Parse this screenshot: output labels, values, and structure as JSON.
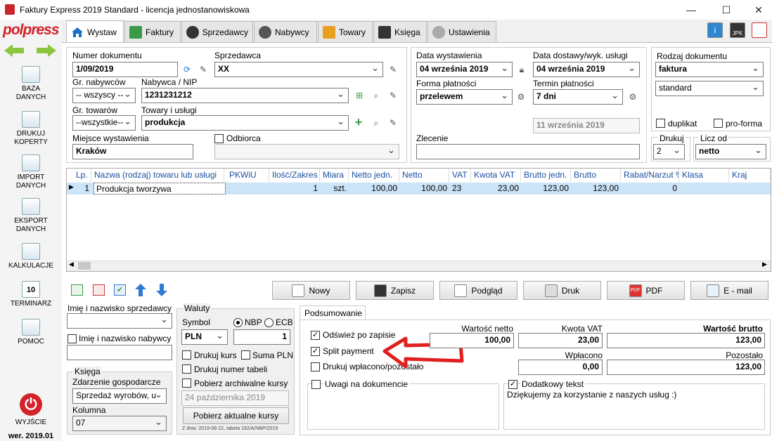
{
  "window": {
    "title": "Faktury Express 2019 Standard - licencja jednostanowiskowa"
  },
  "sidebar": {
    "logo": "polpress",
    "items": [
      {
        "label": "BAZA DANYCH"
      },
      {
        "label": "DRUKUJ KOPERTY"
      },
      {
        "label": "IMPORT DANYCH"
      },
      {
        "label": "EKSPORT DANYCH"
      },
      {
        "label": "KALKULACJE"
      },
      {
        "label": "TERMINARZ"
      },
      {
        "label": "POMOC"
      },
      {
        "label": "WYJŚCIE"
      }
    ],
    "calendar_day": "10",
    "version": "wer. 2019.01"
  },
  "tabs": [
    {
      "label": "Wystaw"
    },
    {
      "label": "Faktury"
    },
    {
      "label": "Sprzedawcy"
    },
    {
      "label": "Nabywcy"
    },
    {
      "label": "Towary"
    },
    {
      "label": "Księga"
    },
    {
      "label": "Ustawienia"
    }
  ],
  "top_right_icons": {
    "jpk": "JPK"
  },
  "form": {
    "numer_label": "Numer dokumentu",
    "numer_value": "1/09/2019",
    "sprzedawca_label": "Sprzedawca",
    "sprzedawca_value": "XX",
    "gr_nabywcow_label": "Gr. nabywców",
    "gr_nabywcow_value": "-- wszyscy --",
    "nabywca_label": "Nabywca / NIP",
    "nabywca_value": "1231231212",
    "gr_towarow_label": "Gr. towarów",
    "gr_towarow_value": "--wszystkie--",
    "towary_label": "Towary i usługi",
    "towary_value": "produkcja",
    "miejsce_label": "Miejsce wystawienia",
    "miejsce_value": "Kraków",
    "odbiorca_label": "Odbiorca",
    "data_wyst_label": "Data wystawienia",
    "data_wyst_value": "04  września  2019",
    "data_dost_label": "Data dostawy/wyk. usługi",
    "data_dost_value": "04  września  2019",
    "forma_label": "Forma płatności",
    "forma_value": "przelewem",
    "termin_label": "Termin płatności",
    "termin_value": "7 dni",
    "termin_date_value": "11  września  2019",
    "zlecenie_label": "Zlecenie",
    "rodzaj_label": "Rodzaj dokumentu",
    "rodzaj_value": "faktura",
    "rodzaj2_value": "standard",
    "duplikat_label": "duplikat",
    "proforma_label": "pro-forma",
    "drukuj_label": "Drukuj",
    "drukuj_value": "2",
    "licz_label": "Licz od",
    "licz_value": "netto"
  },
  "table": {
    "headers": [
      "Lp.",
      "Nazwa (rodzaj) towaru lub usługi",
      "PKWiU",
      "Ilość/Zakres",
      "Miara",
      "Netto jedn.",
      "Netto",
      "VAT",
      "Kwota VAT",
      "Brutto jedn.",
      "Brutto",
      "Rabat/Narzut %",
      "Klasa",
      "Kraj"
    ],
    "rows": [
      {
        "lp": "1",
        "nazwa": "Produkcja tworzywa",
        "pkwiu": "",
        "ilosc": "1",
        "miara": "szt.",
        "netto_jedn": "100,00",
        "netto": "100,00",
        "vat": "23",
        "kwota_vat": "23,00",
        "brutto_jedn": "123,00",
        "brutto": "123,00",
        "rabat": "0",
        "klasa": "",
        "kraj": ""
      }
    ]
  },
  "buttons": {
    "nowy": "Nowy",
    "zapisz": "Zapisz",
    "podglad": "Podgląd",
    "druk": "Druk",
    "pdf": "PDF",
    "email": "E - mail",
    "pdf_icon": "PDF"
  },
  "bottom_left": {
    "sprzedawca_label": "Imię i nazwisko sprzedawcy",
    "nabywca_label": "Imię i nazwisko nabywcy",
    "ksiega_label": "Księga",
    "zdarzenie_label": "Zdarzenie gospodarcze",
    "zdarzenie_value": "Sprzedaż wyrobów, u",
    "kolumna_label": "Kolumna",
    "kolumna_value": "07"
  },
  "waluty": {
    "title": "Waluty",
    "symbol_label": "Symbol",
    "symbol_value": "PLN",
    "nbp_label": "NBP",
    "ecb_label": "ECB",
    "kurs_value": "1",
    "drukuj_kurs": "Drukuj kurs",
    "suma_pln": "Suma PLN",
    "drukuj_numer": "Drukuj numer tabeli",
    "pobierz_arch": "Pobierz archiwalne kursy",
    "arch_date": "24  października  2019",
    "pobierz_btn": "Pobierz aktualne kursy",
    "note": "Z dnia: 2019-08-22, tabela 162/A/NBP/2019"
  },
  "podsumowanie": {
    "tab_label": "Podsumowanie",
    "odswiez": "Odśwież po zapisie",
    "split": "Split payment",
    "wplacono": "Drukuj wpłacono/pozostało",
    "wartosc_netto_label": "Wartość netto",
    "wartosc_netto": "100,00",
    "kwota_vat_label": "Kwota VAT",
    "kwota_vat": "23,00",
    "wartosc_brutto_label": "Wartość brutto",
    "wartosc_brutto": "123,00",
    "wplacono_label": "Wpłacono",
    "wplacono_value": "0,00",
    "pozostalo_label": "Pozostało",
    "pozostalo_value": "123,00",
    "uwagi_label": "Uwagi na dokumencie",
    "dodatkowy_label": "Dodatkowy tekst",
    "dodatkowy_text": "Dziękujemy za korzystanie z naszych usług :)"
  },
  "colors": {
    "accent": "#d2232a",
    "selection": "#cce4f7",
    "grid_header": "#1a4fa0",
    "arrow": "#e02020"
  }
}
